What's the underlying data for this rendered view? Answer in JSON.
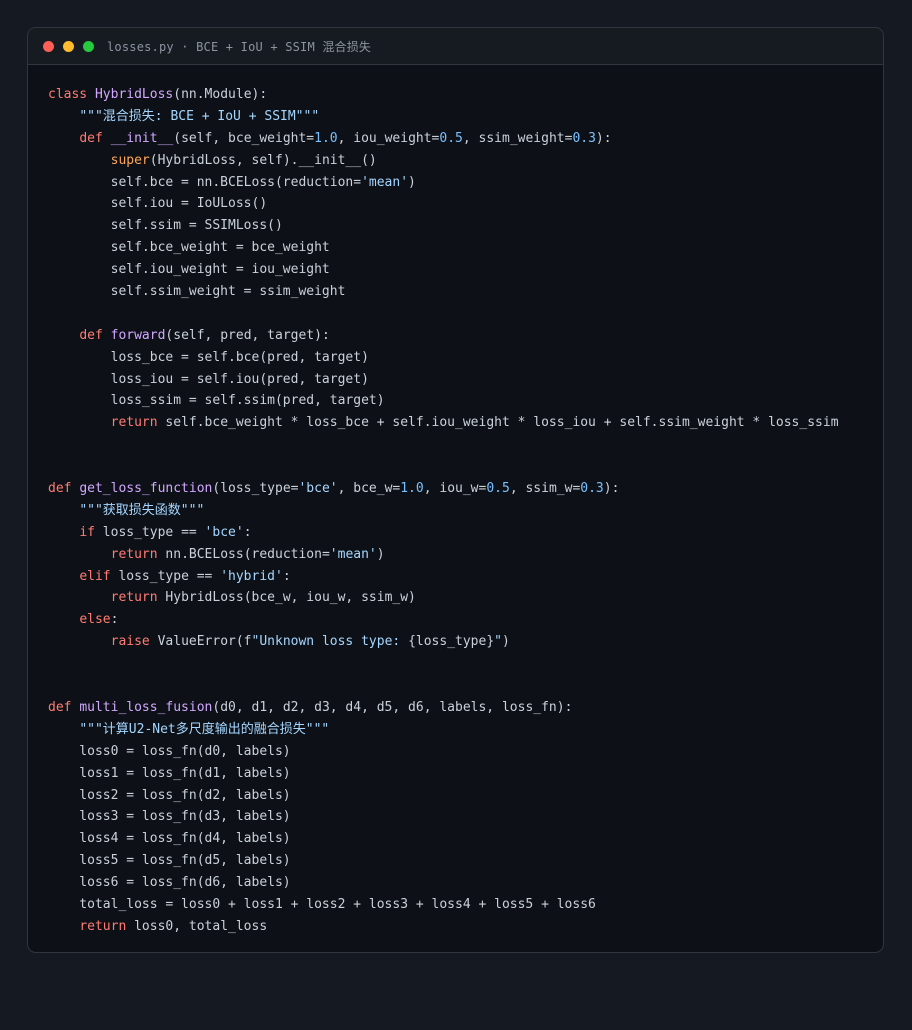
{
  "window": {
    "title": "losses.py · BCE + IoU + SSIM 混合损失"
  },
  "colors": {
    "background": "#151922",
    "editor": "#0d1117",
    "titlebar": "#161b22",
    "keyword": "#ff7b72",
    "function": "#d2a8ff",
    "string": "#a5d6ff",
    "number": "#79c0ff",
    "builtin": "#ffa657",
    "plain": "#c9d1d9"
  },
  "code_lines": [
    [
      [
        "k",
        "class "
      ],
      [
        "f",
        "HybridLoss"
      ],
      [
        "p",
        "(nn.Module):"
      ]
    ],
    [
      [
        "p",
        "    "
      ],
      [
        "s",
        "\"\"\"混合损失: BCE + IoU + SSIM\"\"\""
      ]
    ],
    [
      [
        "p",
        "    "
      ],
      [
        "k",
        "def "
      ],
      [
        "f",
        "__init__"
      ],
      [
        "p",
        "(self, bce_weight="
      ],
      [
        "n",
        "1.0"
      ],
      [
        "p",
        ", iou_weight="
      ],
      [
        "n",
        "0.5"
      ],
      [
        "p",
        ", ssim_weight="
      ],
      [
        "n",
        "0.3"
      ],
      [
        "p",
        "):"
      ]
    ],
    [
      [
        "p",
        "        "
      ],
      [
        "b",
        "super"
      ],
      [
        "p",
        "(HybridLoss, self).__init__()"
      ]
    ],
    [
      [
        "p",
        "        self.bce = nn.BCELoss(reduction="
      ],
      [
        "s",
        "'mean'"
      ],
      [
        "p",
        ")"
      ]
    ],
    [
      [
        "p",
        "        self.iou = IoULoss()"
      ]
    ],
    [
      [
        "p",
        "        self.ssim = SSIMLoss()"
      ]
    ],
    [
      [
        "p",
        "        self.bce_weight = bce_weight"
      ]
    ],
    [
      [
        "p",
        "        self.iou_weight = iou_weight"
      ]
    ],
    [
      [
        "p",
        "        self.ssim_weight = ssim_weight"
      ]
    ],
    [],
    [
      [
        "p",
        "    "
      ],
      [
        "k",
        "def "
      ],
      [
        "f",
        "forward"
      ],
      [
        "p",
        "(self, pred, target):"
      ]
    ],
    [
      [
        "p",
        "        loss_bce = self.bce(pred, target)"
      ]
    ],
    [
      [
        "p",
        "        loss_iou = self.iou(pred, target)"
      ]
    ],
    [
      [
        "p",
        "        loss_ssim = self.ssim(pred, target)"
      ]
    ],
    [
      [
        "p",
        "        "
      ],
      [
        "k",
        "return "
      ],
      [
        "p",
        "self.bce_weight * loss_bce + self.iou_weight * loss_iou + self.ssim_weight * loss_ssim"
      ]
    ],
    [],
    [],
    [
      [
        "k",
        "def "
      ],
      [
        "f",
        "get_loss_function"
      ],
      [
        "p",
        "(loss_type="
      ],
      [
        "s",
        "'bce'"
      ],
      [
        "p",
        ", bce_w="
      ],
      [
        "n",
        "1.0"
      ],
      [
        "p",
        ", iou_w="
      ],
      [
        "n",
        "0.5"
      ],
      [
        "p",
        ", ssim_w="
      ],
      [
        "n",
        "0.3"
      ],
      [
        "p",
        "):"
      ]
    ],
    [
      [
        "p",
        "    "
      ],
      [
        "s",
        "\"\"\"获取损失函数\"\"\""
      ]
    ],
    [
      [
        "p",
        "    "
      ],
      [
        "k",
        "if "
      ],
      [
        "p",
        "loss_type == "
      ],
      [
        "s",
        "'bce'"
      ],
      [
        "p",
        ":"
      ]
    ],
    [
      [
        "p",
        "        "
      ],
      [
        "k",
        "return "
      ],
      [
        "p",
        "nn.BCELoss(reduction="
      ],
      [
        "s",
        "'mean'"
      ],
      [
        "p",
        ")"
      ]
    ],
    [
      [
        "p",
        "    "
      ],
      [
        "k",
        "elif "
      ],
      [
        "p",
        "loss_type == "
      ],
      [
        "s",
        "'hybrid'"
      ],
      [
        "p",
        ":"
      ]
    ],
    [
      [
        "p",
        "        "
      ],
      [
        "k",
        "return "
      ],
      [
        "p",
        "HybridLoss(bce_w, iou_w, ssim_w)"
      ]
    ],
    [
      [
        "p",
        "    "
      ],
      [
        "k",
        "else"
      ],
      [
        "p",
        ":"
      ]
    ],
    [
      [
        "p",
        "        "
      ],
      [
        "k",
        "raise "
      ],
      [
        "p",
        "ValueError(f"
      ],
      [
        "s",
        "\"Unknown loss type: "
      ],
      [
        "p",
        "{loss_type}"
      ],
      [
        "s",
        "\""
      ],
      [
        "p",
        ")"
      ]
    ],
    [],
    [],
    [
      [
        "k",
        "def "
      ],
      [
        "f",
        "multi_loss_fusion"
      ],
      [
        "p",
        "(d0, d1, d2, d3, d4, d5, d6, labels, loss_fn):"
      ]
    ],
    [
      [
        "p",
        "    "
      ],
      [
        "s",
        "\"\"\"计算U2-Net多尺度输出的融合损失\"\"\""
      ]
    ],
    [
      [
        "p",
        "    loss0 = loss_fn(d0, labels)"
      ]
    ],
    [
      [
        "p",
        "    loss1 = loss_fn(d1, labels)"
      ]
    ],
    [
      [
        "p",
        "    loss2 = loss_fn(d2, labels)"
      ]
    ],
    [
      [
        "p",
        "    loss3 = loss_fn(d3, labels)"
      ]
    ],
    [
      [
        "p",
        "    loss4 = loss_fn(d4, labels)"
      ]
    ],
    [
      [
        "p",
        "    loss5 = loss_fn(d5, labels)"
      ]
    ],
    [
      [
        "p",
        "    loss6 = loss_fn(d6, labels)"
      ]
    ],
    [
      [
        "p",
        "    total_loss = loss0 + loss1 + loss2 + loss3 + loss4 + loss5 + loss6"
      ]
    ],
    [
      [
        "p",
        "    "
      ],
      [
        "k",
        "return "
      ],
      [
        "p",
        "loss0, total_loss"
      ]
    ]
  ]
}
